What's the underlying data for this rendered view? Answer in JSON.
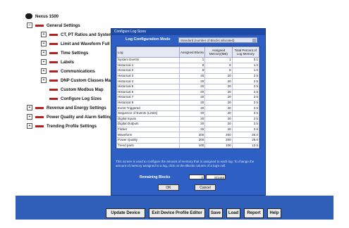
{
  "tree": {
    "root": "Nexus 1500",
    "general": "General Settings",
    "children": [
      "CT, PT Ratios and System H",
      "Limit and Waveform Full Sc",
      "Time Settings",
      "Labels",
      "Communications",
      "DNP Custom Classes Map",
      "Custom Modbus Map",
      "Configure Log Sizes"
    ],
    "others": [
      "Revenue and Energy Settings",
      "Power Quality and Alarm Settings",
      "Trending Profile Settings"
    ]
  },
  "dialog": {
    "title": "Configure Log Sizes",
    "mode_label": "Log Configuration Mode",
    "mode_value": "Standard (number of Blocks allocated)",
    "columns": [
      "Log",
      "Assigned Blocks",
      "Assigned Memory(MB)",
      "Total Percent of Log Memory"
    ],
    "rows": [
      {
        "log": "System Events",
        "blocks": "1",
        "mb": "1",
        "pct": "0.1"
      },
      {
        "log": "Historical 1",
        "blocks": "8",
        "mb": "8",
        "pct": "1.0"
      },
      {
        "log": "Historical 2",
        "blocks": "8",
        "mb": "8",
        "pct": "1.0"
      },
      {
        "log": "Historical 3",
        "blocks": "20",
        "mb": "20",
        "pct": "2.5"
      },
      {
        "log": "Historical 4",
        "blocks": "20",
        "mb": "20",
        "pct": "2.5"
      },
      {
        "log": "Historical 5",
        "blocks": "20",
        "mb": "20",
        "pct": "2.5"
      },
      {
        "log": "Historical 6",
        "blocks": "20",
        "mb": "20",
        "pct": "2.5"
      },
      {
        "log": "Historical 7",
        "blocks": "20",
        "mb": "20",
        "pct": "2.5"
      },
      {
        "log": "Historical 8",
        "blocks": "20",
        "mb": "20",
        "pct": "2.5"
      },
      {
        "log": "Event Triggered",
        "blocks": "20",
        "mb": "20",
        "pct": "2.5"
      },
      {
        "log": "Sequence of Events (Limits)",
        "blocks": "20",
        "mb": "20",
        "pct": "2.5"
      },
      {
        "log": "Digital Inputs",
        "blocks": "20",
        "mb": "20",
        "pct": "2.5"
      },
      {
        "log": "Digital Outputs",
        "blocks": "20",
        "mb": "20",
        "pct": "2.5"
      },
      {
        "log": "Flicker",
        "blocks": "20",
        "mb": "20",
        "pct": "2.5"
      },
      {
        "log": "Waveform",
        "blocks": "200",
        "mb": "200",
        "pct": "25.0"
      },
      {
        "log": "Power Quality",
        "blocks": "200",
        "mb": "200",
        "pct": "25.0"
      },
      {
        "log": "Trend parts",
        "blocks": "100",
        "mb": "100",
        "pct": "12.5"
      }
    ],
    "note": "This screen is used to configure the amount of memory that is assigned to each log. To change the amount of memory assigned to a log, click on the Blocks column of a log's cell.",
    "remaining_label": "Remaining Blocks",
    "remaining_blocks": "0",
    "remaining_total": "8/1445",
    "ok": "OK",
    "cancel": "Cancel"
  },
  "buttons": {
    "update": "Update Device",
    "exit": "Exit Device Profile Editor",
    "save": "Save",
    "load": "Load",
    "report": "Report",
    "help": "Help"
  }
}
